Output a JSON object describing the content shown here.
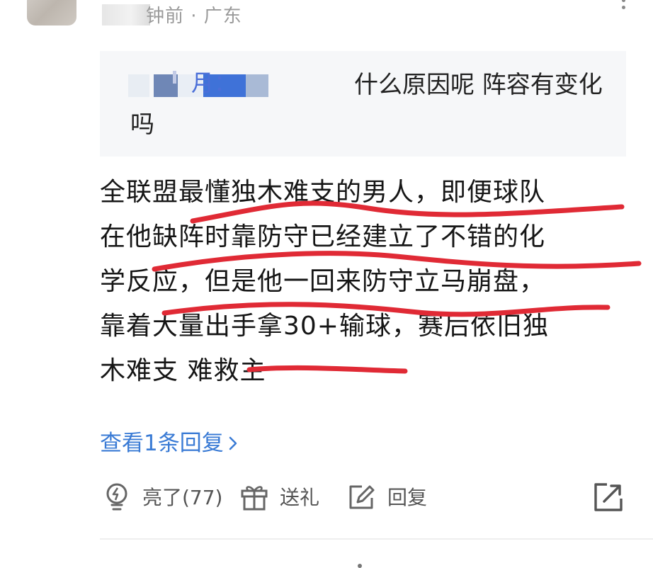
{
  "comment": {
    "time_location": "钟前 · 广东",
    "quoted_reply": {
      "author_suffix": "月：",
      "text": "什么原因呢 阵容有变化吗"
    },
    "body_lines": [
      "全联盟最懂独木难支的男人，即便球队",
      "在他缺阵时靠防守已经建立了不错的化",
      "学反应，但是他一回来防守立马崩盘，",
      "靠着大量出手拿30+输球，赛后依旧独",
      "木难支 难救主"
    ],
    "view_replies": "查看1条回复",
    "actions": {
      "like": "亮了(77)",
      "gift": "送礼",
      "reply": "回复"
    }
  },
  "icons": {
    "more": "more-vertical-icon",
    "like": "lightbulb-icon",
    "gift": "gift-icon",
    "reply": "edit-icon",
    "share": "share-icon",
    "chevron": "chevron-right-icon"
  },
  "colors": {
    "link": "#3a7bd5",
    "mention": "#4b6fd8",
    "annotation": "#e02a35"
  }
}
